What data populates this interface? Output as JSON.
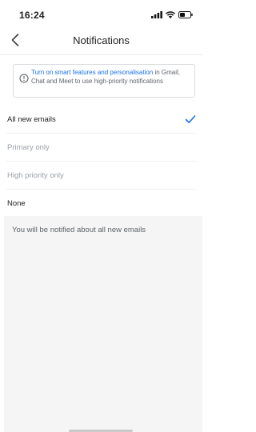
{
  "status_bar": {
    "time": "16:24"
  },
  "nav": {
    "title": "Notifications"
  },
  "info": {
    "link_text": "Turn on smart features and personalisation",
    "text_rest": " in Gmail, Chat and Meet to use high-priority notifications"
  },
  "options": [
    {
      "label": "All new emails",
      "selected": true
    },
    {
      "label": "Primary only",
      "selected": false
    },
    {
      "label": "High priority only",
      "selected": false
    },
    {
      "label": "None",
      "selected": false
    }
  ],
  "description": "You will be notified about all new emails",
  "colors": {
    "accent": "#1a73e8",
    "check": "#1a73e8"
  },
  "icons": [
    "cellular-signal-icon",
    "wifi-icon",
    "battery-icon",
    "back-arrow-icon",
    "info-icon",
    "checkmark-icon"
  ]
}
